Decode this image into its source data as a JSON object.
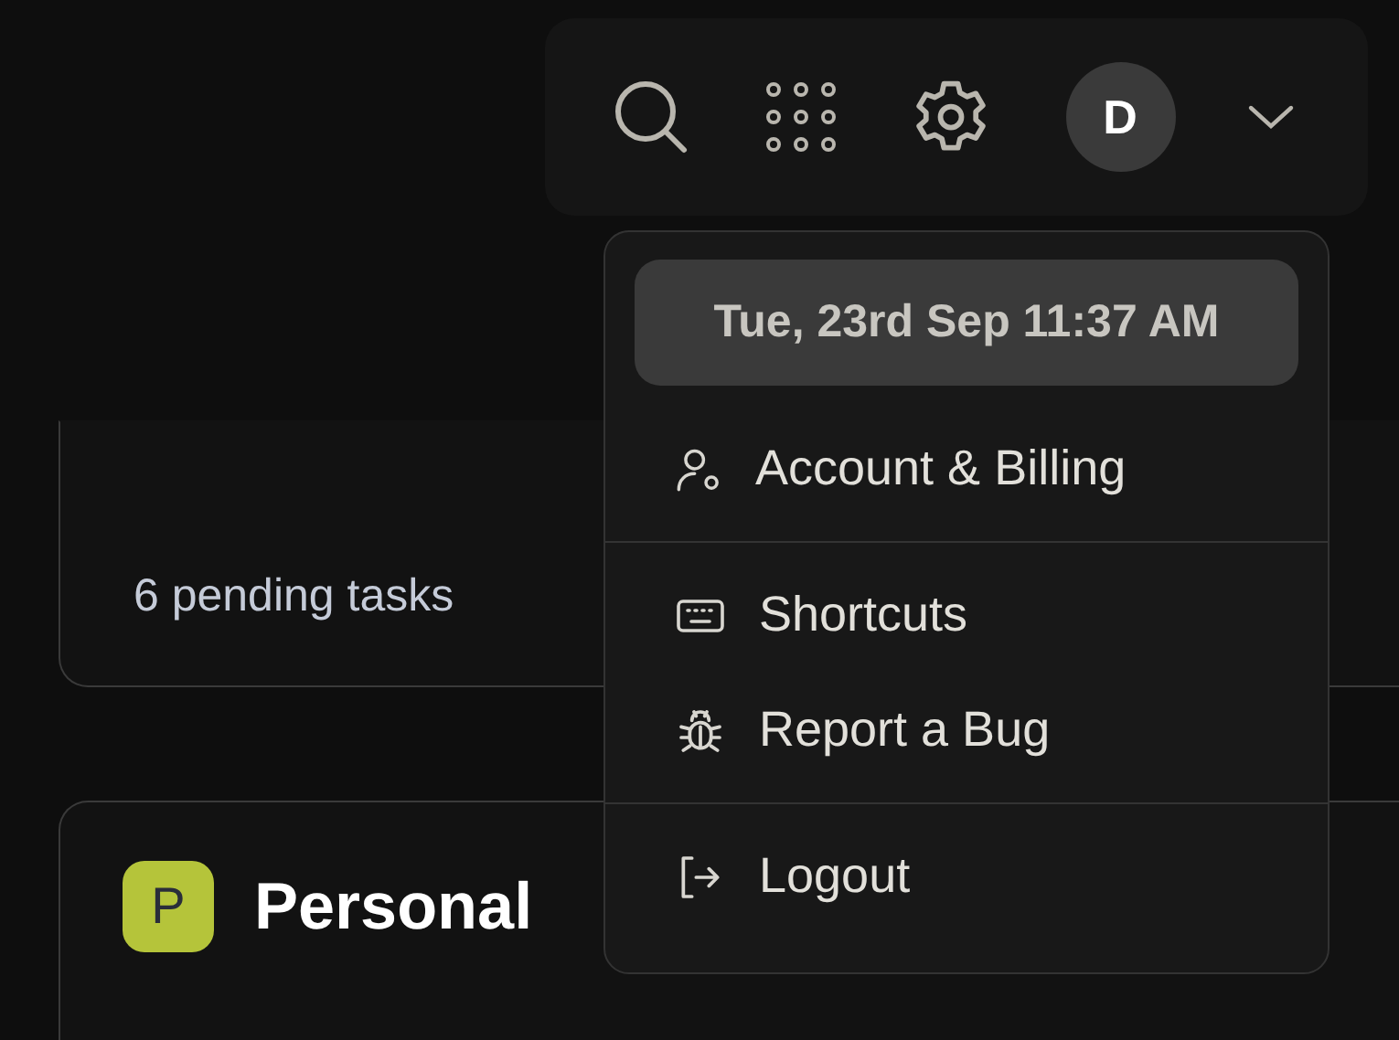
{
  "toolbar": {
    "avatar": "D"
  },
  "menu": {
    "datetime": "Tue, 23rd Sep 11:37 AM",
    "groups": [
      [
        {
          "kind": "account",
          "label": "Account & Billing"
        }
      ],
      [
        {
          "kind": "shortcuts",
          "label": "Shortcuts"
        },
        {
          "kind": "bug",
          "label": "Report a Bug"
        }
      ],
      [
        {
          "kind": "logout",
          "label": "Logout"
        }
      ]
    ]
  },
  "cards": [
    {
      "kind": "summary",
      "text": "6 pending tasks"
    },
    {
      "kind": "project",
      "badge": "P",
      "color": "#b5c43a",
      "title": "Personal"
    }
  ]
}
